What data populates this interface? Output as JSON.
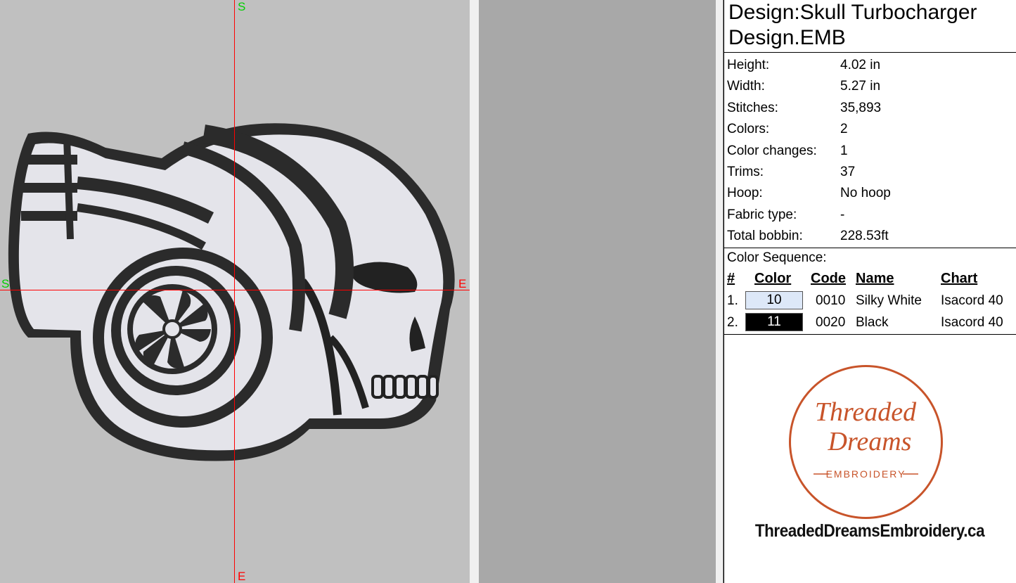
{
  "canvas": {
    "axis_labels": {
      "top": "S",
      "left": "S",
      "right": "E",
      "bottom": "E"
    }
  },
  "design": {
    "title_line1": "Design:Skull Turbocharger",
    "title_line2": "Design.EMB"
  },
  "properties": [
    {
      "label": "Height:",
      "value": "4.02 in"
    },
    {
      "label": "Width:",
      "value": "5.27 in"
    },
    {
      "label": "Stitches:",
      "value": "35,893"
    },
    {
      "label": "Colors:",
      "value": "2"
    },
    {
      "label": "Color changes:",
      "value": "1"
    },
    {
      "label": "Trims:",
      "value": "37"
    },
    {
      "label": "Hoop:",
      "value": "No hoop"
    },
    {
      "label": "Fabric type:",
      "value": "-"
    },
    {
      "label": "Total bobbin:",
      "value": "228.53ft"
    }
  ],
  "color_sequence": {
    "title": "Color Sequence:",
    "headers": {
      "num": "#",
      "color": "Color",
      "code": "Code",
      "name": "Name",
      "chart": "Chart"
    },
    "rows": [
      {
        "num": "1.",
        "color": "10",
        "swatch": "#dde8f8",
        "text_color": "#000000",
        "code": "0010",
        "name": "Silky White",
        "chart": "Isacord 40"
      },
      {
        "num": "2.",
        "color": "11",
        "swatch": "#000000",
        "text_color": "#ffffff",
        "code": "0020",
        "name": "Black",
        "chart": "Isacord 40"
      }
    ]
  },
  "branding": {
    "logo_line1": "Threaded",
    "logo_line2": "Dreams",
    "logo_line3": "EMBROIDERY",
    "website": "ThreadedDreamsEmbroidery.ca",
    "accent_color": "#c8542a"
  }
}
